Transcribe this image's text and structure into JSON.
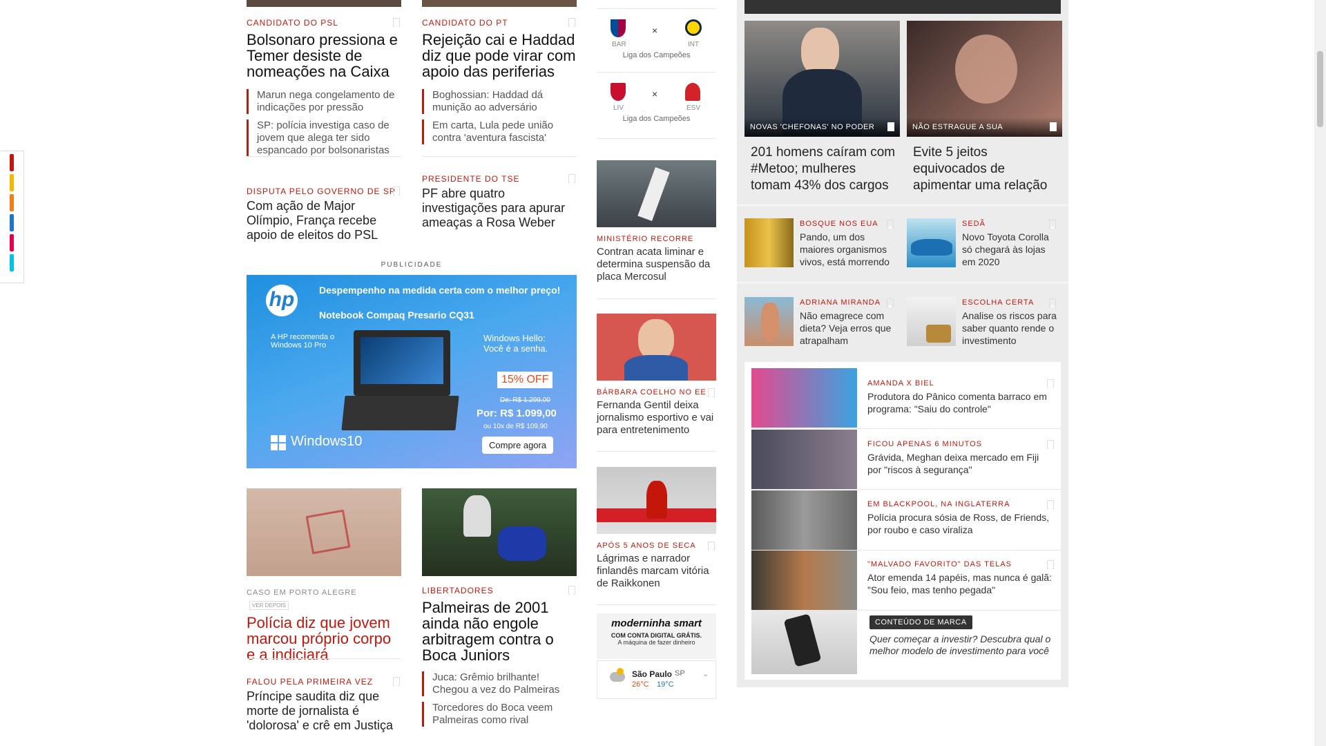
{
  "left_col": {
    "story1": {
      "kicker": "CANDIDATO DO PSL",
      "headline": "Bolsonaro pressiona e Temer desiste de nomeações na Caixa",
      "related": [
        "Marun nega congelamento de indicações por pressão",
        "SP: polícia investiga caso de jovem que alega ter sido espancado por bolsonaristas"
      ]
    },
    "story2": {
      "kicker": "CANDIDATO DO PT",
      "headline": "Rejeição cai e Haddad diz que pode virar com apoio das periferias",
      "related": [
        "Boghossian: Haddad dá munição ao adversário",
        "Em carta, Lula pede união contra 'aventura fascista'"
      ]
    },
    "story3": {
      "kicker": "DISPUTA PELO GOVERNO DE SP",
      "headline": "Com ação de Major Olímpio, França recebe apoio de eleitos do PSL"
    },
    "story4": {
      "kicker": "PRESIDENTE DO TSE",
      "headline": "PF abre quatro investigações para apurar ameaças a Rosa Weber"
    },
    "ad": {
      "label": "PUBLICIDADE",
      "tagline": "Despempenho na medida certa com o melhor preço!",
      "product": "Notebook Compaq Presario CQ31",
      "recommend": "A HP recomenda o Windows 10 Pro",
      "hello": "Windows Hello: Você é a senha.",
      "discount": "15% OFF",
      "old_price": "De: R$ 1.299,00",
      "price": "Por: R$ 1.099,00",
      "installments": "ou 10x de R$ 109,90",
      "cta": "Compre agora",
      "windows": "Windows10",
      "brand": "hp"
    },
    "story5": {
      "kicker": "CASO EM PORTO ALEGRE",
      "later": "VER DEPOIS",
      "headline": "Polícia diz que jovem marcou próprio corpo e a indiciará"
    },
    "story6": {
      "kicker": "LIBERTADORES",
      "headline": "Palmeiras de 2001 ainda não engole arbitragem contra o Boca Juniors",
      "related": [
        "Juca: Grêmio brilhante! Chegou a vez do Palmeiras",
        "Torcedores do Boca veem Palmeiras como rival"
      ]
    },
    "story7": {
      "kicker": "FALOU PELA PRIMEIRA VEZ",
      "headline": "Príncipe saudita diz que morte de jornalista é 'dolorosa' e crê em Justiça"
    }
  },
  "mid_col": {
    "match1": {
      "home": "BAR",
      "away": "INT",
      "vs": "×",
      "league": "Liga dos Campeões"
    },
    "match2": {
      "home": "LIV",
      "away": "ESV",
      "vs": "×",
      "league": "Liga dos Campeões"
    },
    "story1": {
      "kicker": "MINISTÉRIO RECORRE",
      "headline": "Contran acata liminar e determina suspensão da placa Mercosul"
    },
    "story2": {
      "kicker": "BÁRBARA COELHO NO EE",
      "headline": "Fernanda Gentil deixa jornalismo esportivo e vai para entretenimento"
    },
    "story3": {
      "kicker": "APÓS 5 ANOS DE SECA",
      "headline": "Lágrimas e narrador finlandês marcam vitória de Raikkonen"
    },
    "moderninha": {
      "brand": "moderninha smart",
      "line1": "COM CONTA DIGITAL GRÁTIS.",
      "line2": "A máquina de fazer dinheiro"
    },
    "weather": {
      "city": "São Paulo",
      "state": "SP",
      "max": "26°C",
      "min": "19°C"
    }
  },
  "right_col": {
    "card1": {
      "overlay": "NOVAS 'CHEFONAS' NO PODER",
      "headline": "201 homens caíram com #Metoo; mulheres tomam 43% dos cargos"
    },
    "card2": {
      "overlay": "NÃO ESTRAGUE A SUA",
      "headline": "Evite 5 jeitos equivocados de apimentar uma relação"
    },
    "small1": {
      "kicker": "BOSQUE NOS EUA",
      "headline": "Pando, um dos maiores organismos vivos, está morrendo"
    },
    "small2": {
      "kicker": "SEDÃ",
      "headline": "Novo Toyota Corolla só chegará às lojas em 2020"
    },
    "small3": {
      "kicker": "ADRIANA MIRANDA",
      "headline": "Não emagrece com dieta? Veja erros que atrapalham"
    },
    "small4": {
      "kicker": "ESCOLHA CERTA",
      "headline": "Analise os riscos para saber quanto rende o investimento"
    },
    "list": [
      {
        "kicker": "AMANDA X BIEL",
        "headline": "Produtora do Pânico comenta barraco em programa: \"Saiu do controle\""
      },
      {
        "kicker": "FICOU APENAS 6 MINUTOS",
        "headline": "Grávida, Meghan deixa mercado em Fiji por \"riscos à segurança\""
      },
      {
        "kicker": "EM BLACKPOOL, NA INGLATERRA",
        "headline": "Polícia procura sósia de Ross, de Friends, por roubo e caso viraliza"
      },
      {
        "kicker": "\"MALVADO FAVORITO\" DAS TELAS",
        "headline": "Ator emenda 14 papéis, mas nunca é galã: \"Sou feio, mas tenho pegada\""
      }
    ],
    "brand_content": {
      "badge": "CONTEÚDO DE MARCA",
      "text": "Quer começar a investir? Descubra qual o melhor modelo de investimento para você"
    }
  },
  "colors": {
    "accent": "#c4170c",
    "side_strip": [
      "#c4170c",
      "#f5b800",
      "#f07f19",
      "#1f76c9",
      "#e6004c",
      "#00c3e3"
    ]
  }
}
